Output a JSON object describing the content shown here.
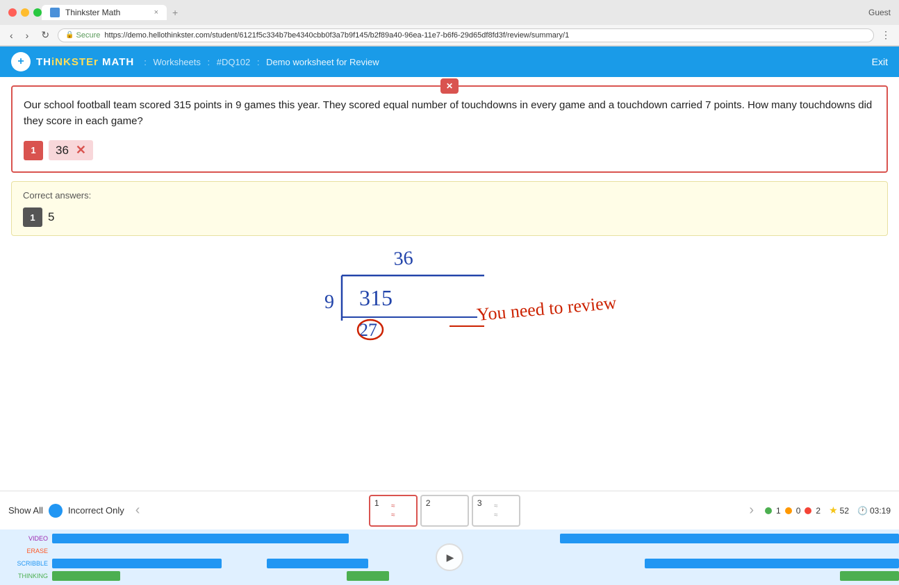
{
  "browser": {
    "dots": [
      "red",
      "yellow",
      "green"
    ],
    "tab_title": "Thinkster Math",
    "tab_close": "×",
    "new_tab": "+",
    "guest_label": "Guest",
    "nav_back": "‹",
    "nav_forward": "›",
    "nav_refresh": "↻",
    "secure_label": "Secure",
    "url": "https://demo.hellothinkster.com/student/6121f5c334b7be4340cbb0f3a7b9f145/b2f89a40-96ea-11e7-b6f6-29d65df8fd3f/review/summary/1",
    "menu": "⋮"
  },
  "header": {
    "logo_text_normal": "TH",
    "logo_text_colored": "iNKSTEr",
    "logo_text_end": " MATH",
    "breadcrumb_sep1": ":",
    "breadcrumb_worksheets": "Worksheets",
    "breadcrumb_sep2": ":",
    "breadcrumb_hash": "#DQ102",
    "breadcrumb_sep3": ":",
    "breadcrumb_current": "Demo worksheet for Review",
    "exit_label": "Exit"
  },
  "question": {
    "close_btn": "✕",
    "text": "Our school football team scored 315 points in 9 games this year. They scored equal number of touchdowns in every game and a touchdown carried 7 points. How many touchdowns did they score in each game?",
    "answer_number": "1",
    "answer_value": "36",
    "wrong_mark": "✕"
  },
  "correct_answers": {
    "label": "Correct answers:",
    "number": "1",
    "value": "5"
  },
  "bottom_nav": {
    "show_all": "Show All",
    "incorrect_only": "Incorrect Only",
    "nav_prev": "‹",
    "nav_next": "›",
    "tiles": [
      {
        "number": "1",
        "active": true,
        "has_icon": true
      },
      {
        "number": "2",
        "active": false,
        "has_icon": false
      },
      {
        "number": "3",
        "active": false,
        "has_icon": true
      }
    ],
    "score_green": "1",
    "score_orange": "0",
    "score_red": "2",
    "star_score": "52",
    "time": "03:19"
  },
  "timeline": {
    "labels": [
      "VIDEO",
      "ERASE",
      "SCRIBBLE",
      "THINKING"
    ],
    "play_btn": "▶"
  }
}
